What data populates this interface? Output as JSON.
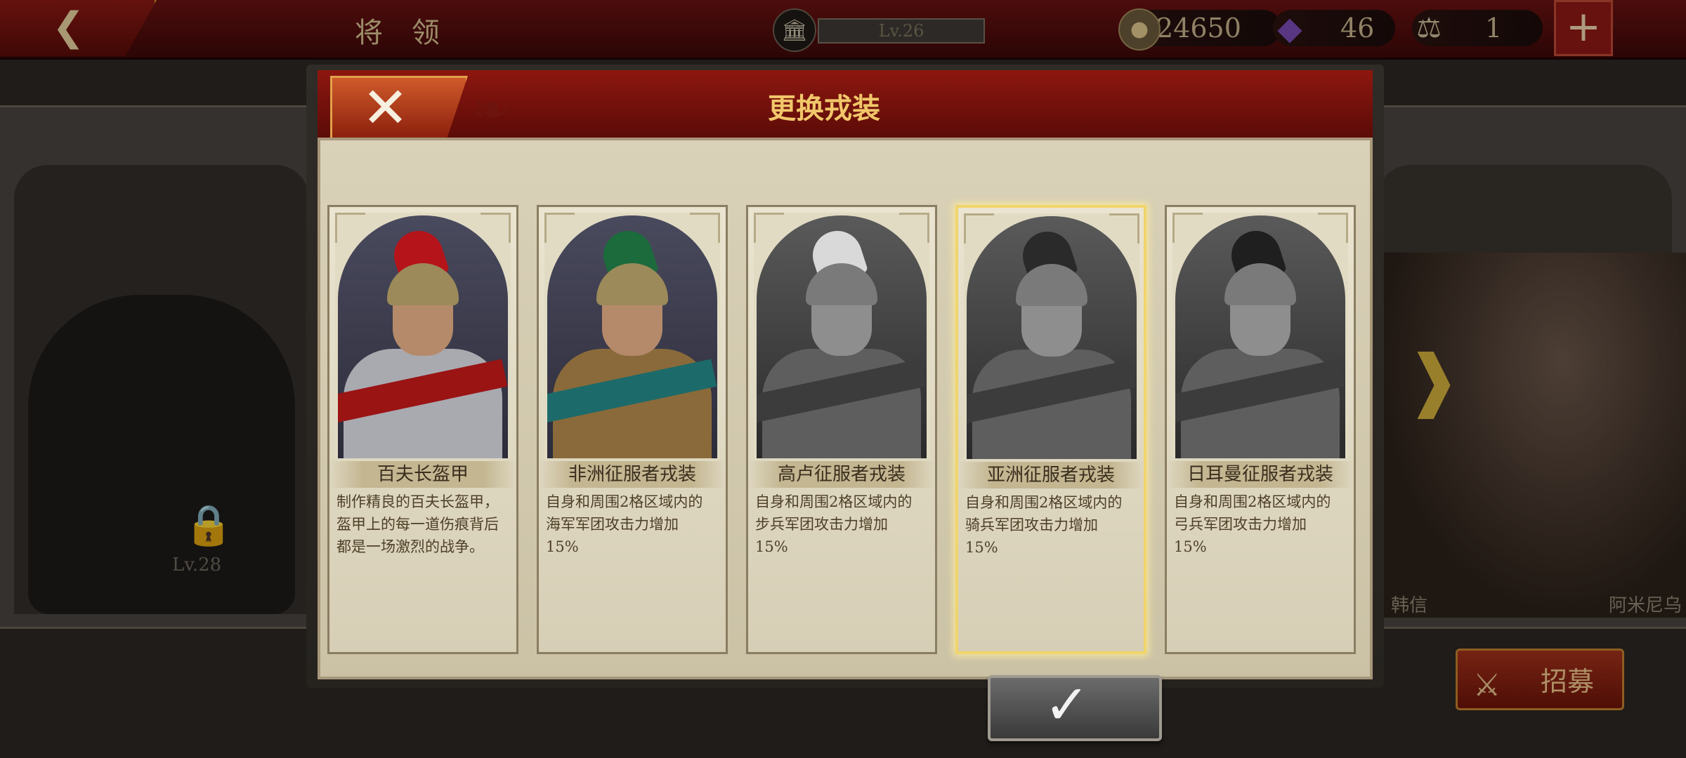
{
  "header": {
    "title": "将 领",
    "level": "Lv.26",
    "coins": "24650",
    "gems": "46",
    "tokens": "1",
    "icons": {
      "back": "chevron-left-icon",
      "level": "bank-icon",
      "coins": "coin-icon",
      "gems": "gem-icon",
      "tokens": "helmet-ticket-icon",
      "add": "plus-icon"
    }
  },
  "background": {
    "locked_level": "Lv.28",
    "hero_left_name": "韩信",
    "hero_right_name": "阿米尼乌",
    "recruit_label": "招募"
  },
  "modal": {
    "title": "更换戎装",
    "selected_index": 3,
    "cards": [
      {
        "name": "百夫长盔甲",
        "desc": "制作精良的百夫长盔甲，\n盔甲上的每一道伤痕背后\n都是一场激烈的战争。",
        "crest": "#b5141a",
        "theme": "color-red"
      },
      {
        "name": "非洲征服者戎装",
        "desc": "自身和周围2格区域内的\n海军军团攻击力增加\n15%",
        "crest": "#1c6b3c",
        "theme": "color-green"
      },
      {
        "name": "高卢征服者戎装",
        "desc": "自身和周围2格区域内的\n步兵军团攻击力增加\n15%",
        "crest": "#d9d9d9",
        "theme": "grayscale"
      },
      {
        "name": "亚洲征服者戎装",
        "desc": "自身和周围2格区域内的\n骑兵军团攻击力增加\n15%",
        "crest": "#2a2a2a",
        "theme": "grayscale"
      },
      {
        "name": "日耳曼征服者戎装",
        "desc": "自身和周围2格区域内的\n弓兵军团攻击力增加\n15%",
        "crest": "#1f1f1f",
        "theme": "grayscale"
      }
    ]
  }
}
